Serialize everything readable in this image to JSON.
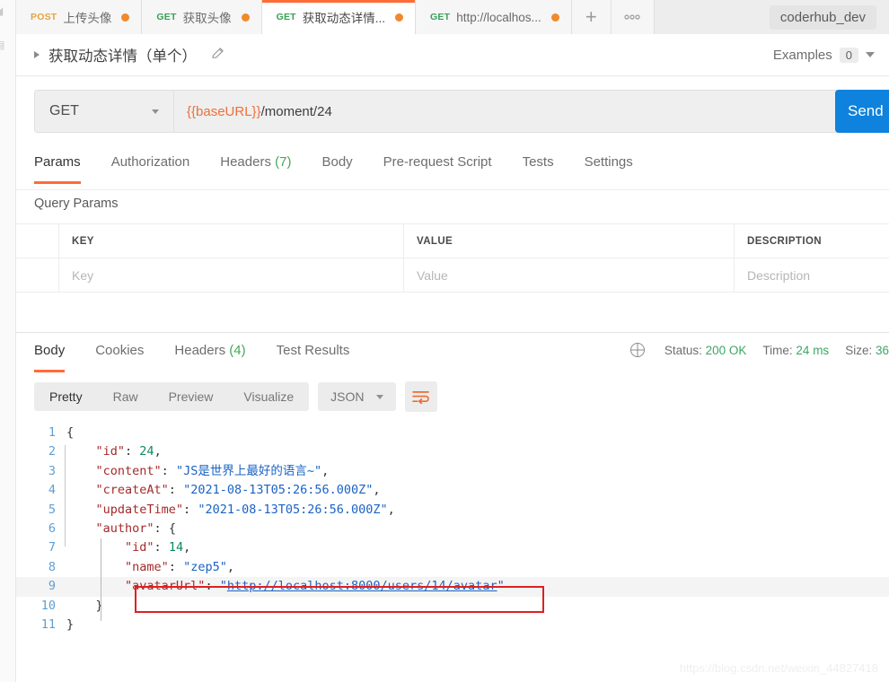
{
  "window": {
    "environment": "coderhub_dev"
  },
  "tabs": [
    {
      "method": "POST",
      "label": "上传头像",
      "unsaved": true,
      "active": false
    },
    {
      "method": "GET",
      "label": "获取头像",
      "unsaved": true,
      "active": false
    },
    {
      "method": "GET",
      "label": "获取动态详情...",
      "unsaved": true,
      "active": true
    },
    {
      "method": "GET",
      "label": "http://localhos...",
      "unsaved": true,
      "active": false
    }
  ],
  "tab_controls": {
    "add_label": "+",
    "more_label": "000"
  },
  "request_header": {
    "title": "获取动态详情（单个）",
    "edit_icon": "pencil-icon",
    "expand_icon": "caret-right-icon",
    "examples_label": "Examples",
    "examples_count": "0"
  },
  "url_bar": {
    "method": "GET",
    "url_variable": "{{baseURL}}",
    "url_path": "/moment/24",
    "send_label": "Send"
  },
  "request_tabs": [
    {
      "label": "Params",
      "count": "",
      "active": true
    },
    {
      "label": "Authorization",
      "count": "",
      "active": false
    },
    {
      "label": "Headers",
      "count": "(7)",
      "active": false
    },
    {
      "label": "Body",
      "count": "",
      "active": false
    },
    {
      "label": "Pre-request Script",
      "count": "",
      "active": false
    },
    {
      "label": "Tests",
      "count": "",
      "active": false
    },
    {
      "label": "Settings",
      "count": "",
      "active": false
    }
  ],
  "query_params": {
    "section_label": "Query Params",
    "columns": [
      "KEY",
      "VALUE",
      "DESCRIPTION"
    ],
    "rows": [
      {
        "key": "Key",
        "value": "Value",
        "description": "Description"
      }
    ]
  },
  "response_tabs": [
    {
      "label": "Body",
      "count": "",
      "active": true
    },
    {
      "label": "Cookies",
      "count": "",
      "active": false
    },
    {
      "label": "Headers",
      "count": "(4)",
      "active": false
    },
    {
      "label": "Test Results",
      "count": "",
      "active": false
    }
  ],
  "response_meta": {
    "globe_icon": "globe-icon",
    "status_label": "Status:",
    "status_value": "200 OK",
    "time_label": "Time:",
    "time_value": "24 ms",
    "size_label": "Size:",
    "size_value": "36"
  },
  "body_toolbar": {
    "views": [
      {
        "label": "Pretty",
        "active": true
      },
      {
        "label": "Raw",
        "active": false
      },
      {
        "label": "Preview",
        "active": false
      },
      {
        "label": "Visualize",
        "active": false
      }
    ],
    "format": "JSON",
    "wrap_icon": "word-wrap-icon"
  },
  "response_body": {
    "language": "json",
    "lines": [
      {
        "no": "1",
        "segments": [
          {
            "t": "{",
            "c": "p"
          }
        ]
      },
      {
        "no": "2",
        "segments": [
          {
            "t": "    \"id\"",
            "c": "k"
          },
          {
            "t": ": ",
            "c": "p"
          },
          {
            "t": "24",
            "c": "n"
          },
          {
            "t": ",",
            "c": "p"
          }
        ]
      },
      {
        "no": "3",
        "segments": [
          {
            "t": "    \"content\"",
            "c": "k"
          },
          {
            "t": ": ",
            "c": "p"
          },
          {
            "t": "\"JS是世界上最好的语言~\"",
            "c": "s"
          },
          {
            "t": ",",
            "c": "p"
          }
        ]
      },
      {
        "no": "4",
        "segments": [
          {
            "t": "    \"createAt\"",
            "c": "k"
          },
          {
            "t": ": ",
            "c": "p"
          },
          {
            "t": "\"2021-08-13T05:26:56.000Z\"",
            "c": "s"
          },
          {
            "t": ",",
            "c": "p"
          }
        ]
      },
      {
        "no": "5",
        "segments": [
          {
            "t": "    \"updateTime\"",
            "c": "k"
          },
          {
            "t": ": ",
            "c": "p"
          },
          {
            "t": "\"2021-08-13T05:26:56.000Z\"",
            "c": "s"
          },
          {
            "t": ",",
            "c": "p"
          }
        ]
      },
      {
        "no": "6",
        "segments": [
          {
            "t": "    \"author\"",
            "c": "k"
          },
          {
            "t": ": ",
            "c": "p"
          },
          {
            "t": "{",
            "c": "p"
          }
        ]
      },
      {
        "no": "7",
        "segments": [
          {
            "t": "        \"id\"",
            "c": "k"
          },
          {
            "t": ": ",
            "c": "p"
          },
          {
            "t": "14",
            "c": "n"
          },
          {
            "t": ",",
            "c": "p"
          }
        ]
      },
      {
        "no": "8",
        "segments": [
          {
            "t": "        \"name\"",
            "c": "k"
          },
          {
            "t": ": ",
            "c": "p"
          },
          {
            "t": "\"zep5\"",
            "c": "s"
          },
          {
            "t": ",",
            "c": "p"
          }
        ]
      },
      {
        "no": "9",
        "highlight": true,
        "segments": [
          {
            "t": "        \"avatarUrl\"",
            "c": "k"
          },
          {
            "t": ": ",
            "c": "p"
          },
          {
            "t": "\"",
            "c": "s"
          },
          {
            "t": "http://localhost:8000/users/14/avatar",
            "c": "s u"
          },
          {
            "t": "\"",
            "c": "s"
          }
        ]
      },
      {
        "no": "10",
        "segments": [
          {
            "t": "    }",
            "c": "p"
          }
        ]
      },
      {
        "no": "11",
        "segments": [
          {
            "t": "}",
            "c": "p"
          }
        ]
      }
    ]
  },
  "annotation": {
    "highlight_box": "red-rectangle-annotation"
  },
  "watermark": "https://blog.csdn.net/weixin_44827418",
  "colors": {
    "accent_orange": "#ff6c37",
    "send_blue": "#0e82dc",
    "status_green": "#3ea665",
    "annotation_red": "#e02020",
    "json_key": "#a52a2a",
    "json_string": "#1a63c4",
    "json_number": "#0c8a5b"
  }
}
